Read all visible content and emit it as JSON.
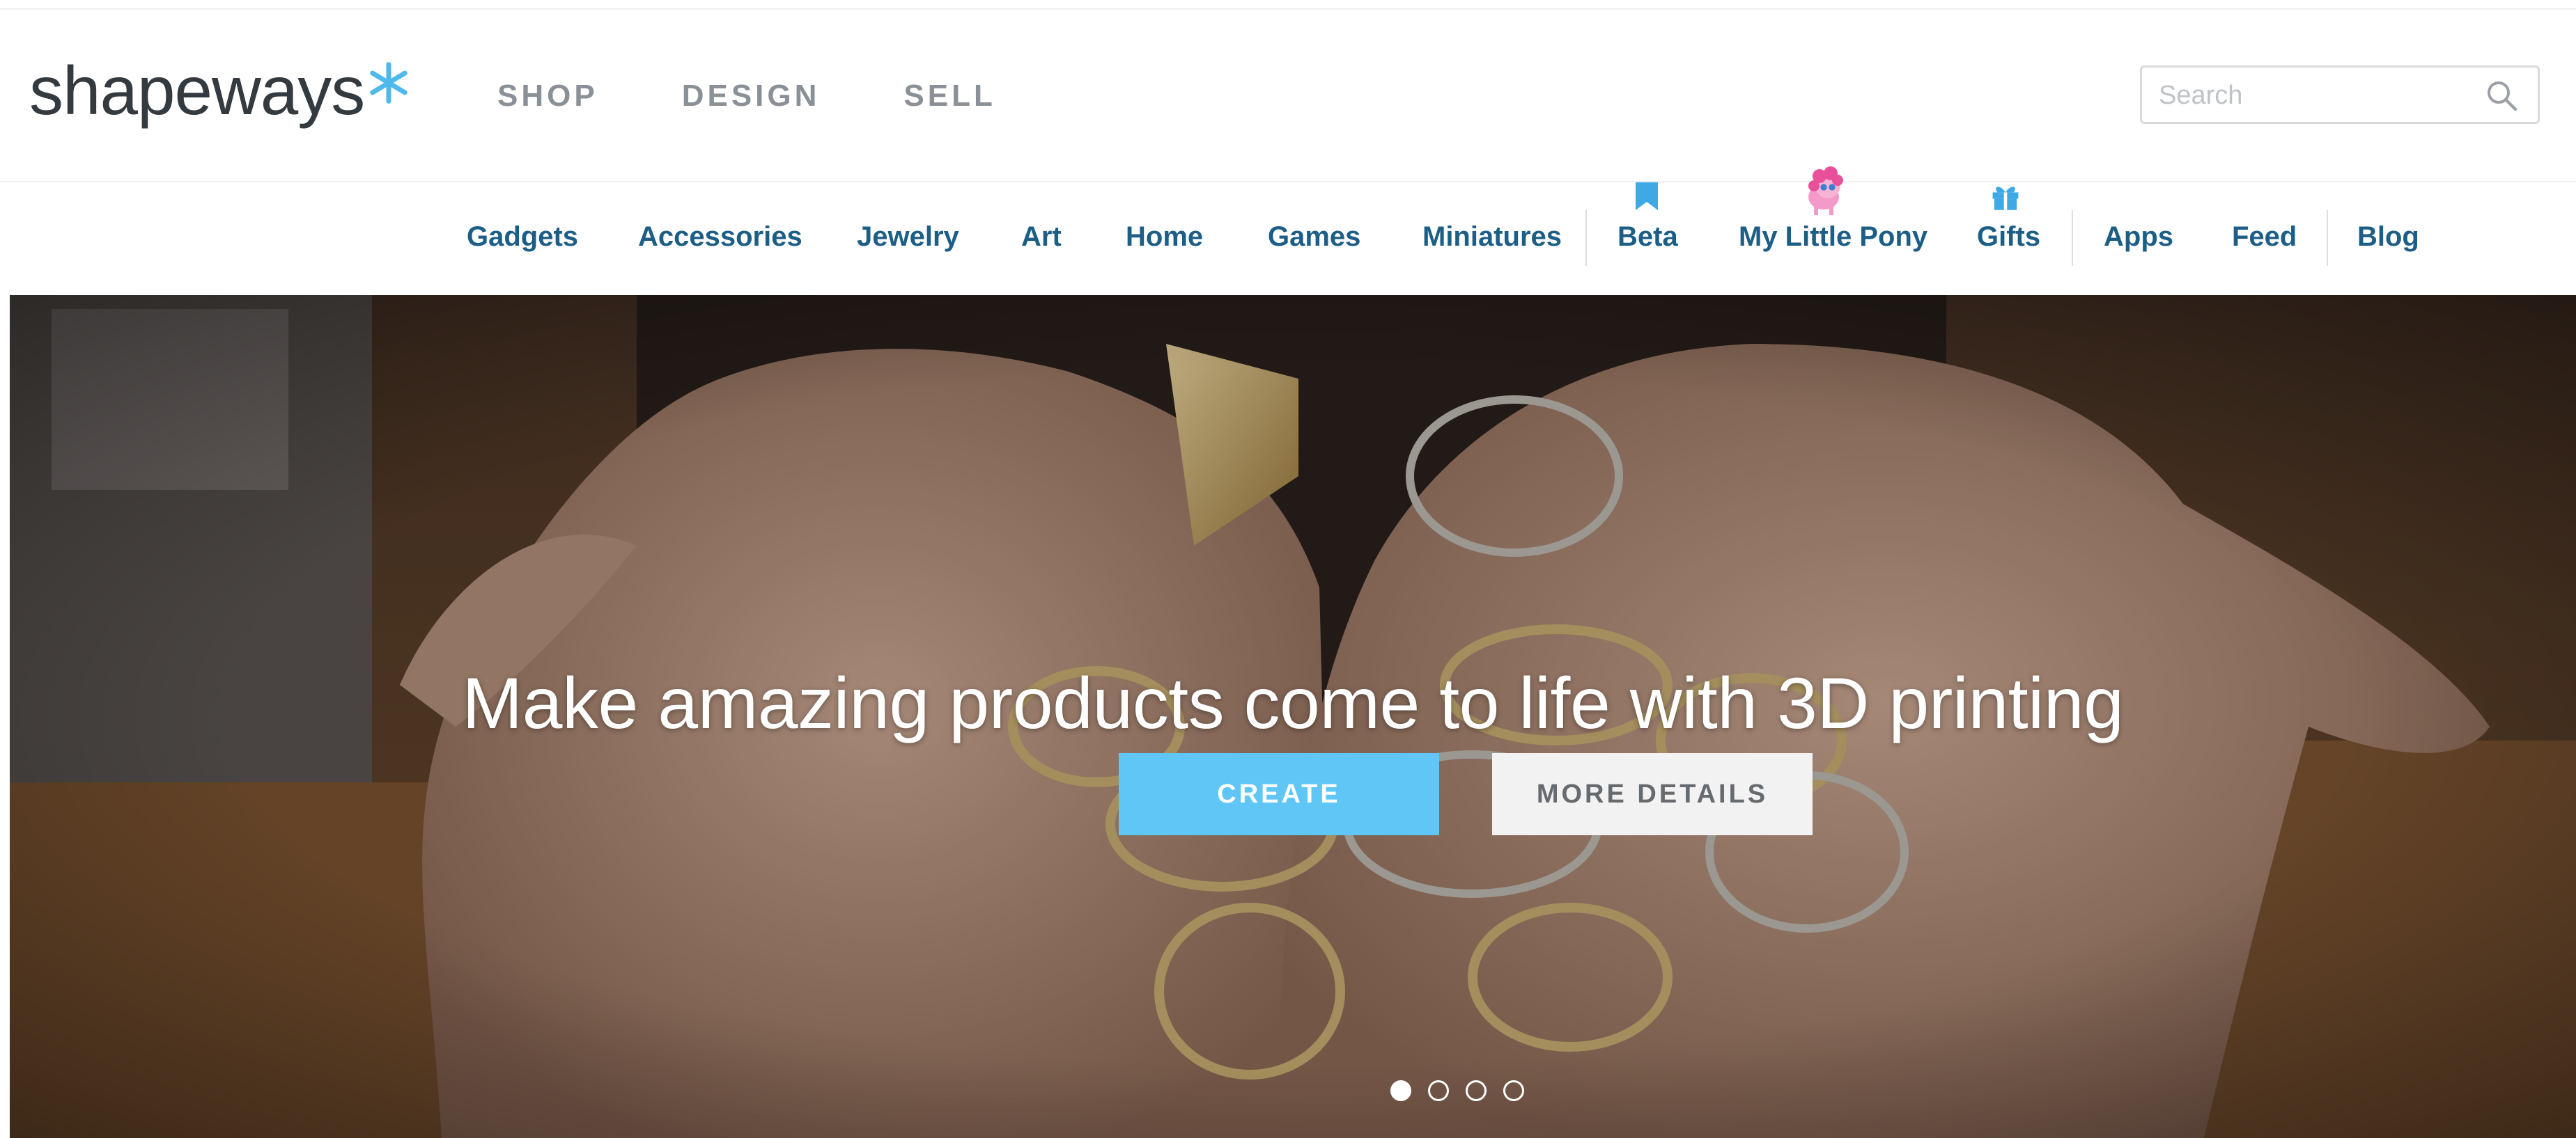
{
  "brand": {
    "name": "shapeways",
    "accent_color": "#4fb9ec",
    "star_icon": "star-icon"
  },
  "main_nav": [
    {
      "label": "SHOP"
    },
    {
      "label": "DESIGN"
    },
    {
      "label": "SELL"
    }
  ],
  "search": {
    "placeholder": "Search",
    "value": "",
    "icon": "search-icon"
  },
  "categories": [
    {
      "label": "Gadgets"
    },
    {
      "label": "Accessories"
    },
    {
      "label": "Jewelry"
    },
    {
      "label": "Art"
    },
    {
      "label": "Home"
    },
    {
      "label": "Games"
    },
    {
      "label": "Miniatures"
    },
    {
      "label": "Beta",
      "icon": "bookmark-icon"
    },
    {
      "label": "My Little Pony",
      "icon": "pony-icon"
    },
    {
      "label": "Gifts",
      "icon": "gift-icon"
    },
    {
      "label": "Apps"
    },
    {
      "label": "Feed"
    },
    {
      "label": "Blog"
    }
  ],
  "hero": {
    "headline": "Make amazing products come to life with 3D printing",
    "primary_button": "CREATE",
    "secondary_button": "MORE DETAILS",
    "slides_total": 4,
    "active_slide": 1,
    "primary_color": "#5fc6f6"
  }
}
